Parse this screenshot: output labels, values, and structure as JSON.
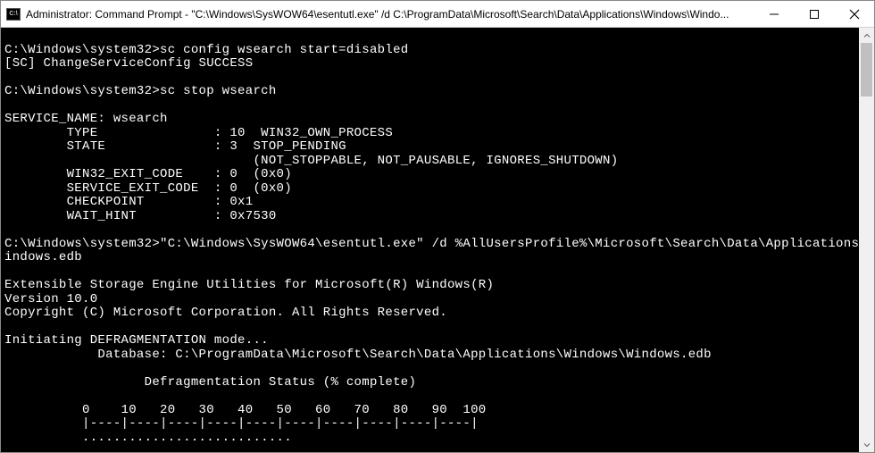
{
  "titlebar": {
    "icon_label": "C:\\",
    "title": "Administrator: Command Prompt - \"C:\\Windows\\SysWOW64\\esentutl.exe\"  /d C:\\ProgramData\\Microsoft\\Search\\Data\\Applications\\Windows\\Windo..."
  },
  "console": {
    "content": "\nC:\\Windows\\system32>sc config wsearch start=disabled\n[SC] ChangeServiceConfig SUCCESS\n\nC:\\Windows\\system32>sc stop wsearch\n\nSERVICE_NAME: wsearch\n        TYPE               : 10  WIN32_OWN_PROCESS\n        STATE              : 3  STOP_PENDING\n                                (NOT_STOPPABLE, NOT_PAUSABLE, IGNORES_SHUTDOWN)\n        WIN32_EXIT_CODE    : 0  (0x0)\n        SERVICE_EXIT_CODE  : 0  (0x0)\n        CHECKPOINT         : 0x1\n        WAIT_HINT          : 0x7530\n\nC:\\Windows\\system32>\"C:\\Windows\\SysWOW64\\esentutl.exe\" /d %AllUsersProfile%\\Microsoft\\Search\\Data\\Applications\\Windows\\W\nindows.edb\n\nExtensible Storage Engine Utilities for Microsoft(R) Windows(R)\nVersion 10.0\nCopyright (C) Microsoft Corporation. All Rights Reserved.\n\nInitiating DEFRAGMENTATION mode...\n            Database: C:\\ProgramData\\Microsoft\\Search\\Data\\Applications\\Windows\\Windows.edb\n\n                  Defragmentation Status (% complete)\n\n          0    10   20   30   40   50   60   70   80   90  100\n          |----|----|----|----|----|----|----|----|----|----|\n          ..........................."
  }
}
